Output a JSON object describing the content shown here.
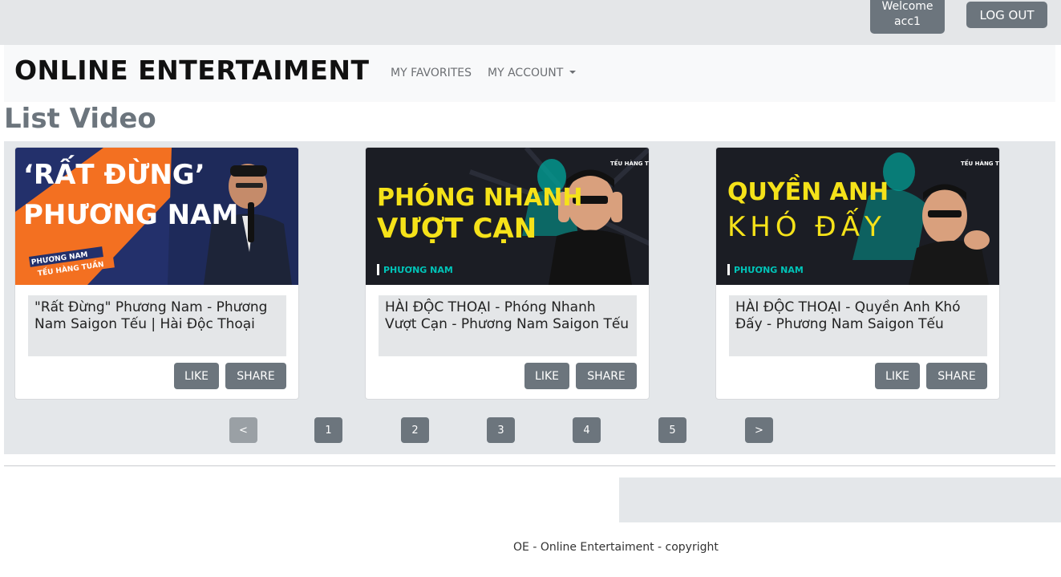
{
  "header": {
    "welcome_line1": "Welcome",
    "welcome_line2": "acc1",
    "logout_label": "LOG OUT"
  },
  "navbar": {
    "brand": "ONLINE ENTERTAIMENT",
    "favorites": "MY FAVORITES",
    "account": "MY ACCOUNT"
  },
  "page_title": "List Video",
  "videos": [
    {
      "title": "\"Rất Đừng\" Phương Nam - Phương Nam Saigon Tếu | Hài Độc Thoại",
      "thumb_line1": "‘RẤT ĐỪNG’",
      "thumb_line2": "PHƯƠNG NAM",
      "thumb_tag": "PHƯƠNG NAM",
      "thumb_tag2": "TẾU HÀNG TUẦN",
      "like": "LIKE",
      "share": "SHARE"
    },
    {
      "title": "HÀI ĐỘC THOẠI - Phóng Nhanh Vượt Cạn - Phương Nam Saigon Tếu",
      "thumb_line1": "PHÓNG NHANH",
      "thumb_line2": "VƯỢT CẠN",
      "thumb_tag": "PHƯƠNG NAM",
      "thumb_badge": "TẾU HÀNG TUẦN",
      "like": "LIKE",
      "share": "SHARE"
    },
    {
      "title": "HÀI ĐỘC THOẠI - Quyền Anh Khó Đấy - Phương Nam Saigon Tếu",
      "thumb_line1": "QUYỀN ANH",
      "thumb_line2": "KHÓ ĐẤY",
      "thumb_tag": "PHƯƠNG NAM",
      "thumb_badge": "TẾU HÀNG TUẦN",
      "like": "LIKE",
      "share": "SHARE"
    }
  ],
  "pagination": {
    "prev": "<",
    "pages": [
      "1",
      "2",
      "3",
      "4",
      "5"
    ],
    "next": ">"
  },
  "footer": {
    "copyright": "OE - Online Entertaiment - copyright"
  },
  "colors": {
    "button": "#6c757d",
    "thumb1_orange": "#f37021",
    "thumb1_navy": "#23306b",
    "thumb_dark": "#1b1d24",
    "thumb_yellow": "#f5e219",
    "thumb_teal": "#00a59b"
  }
}
